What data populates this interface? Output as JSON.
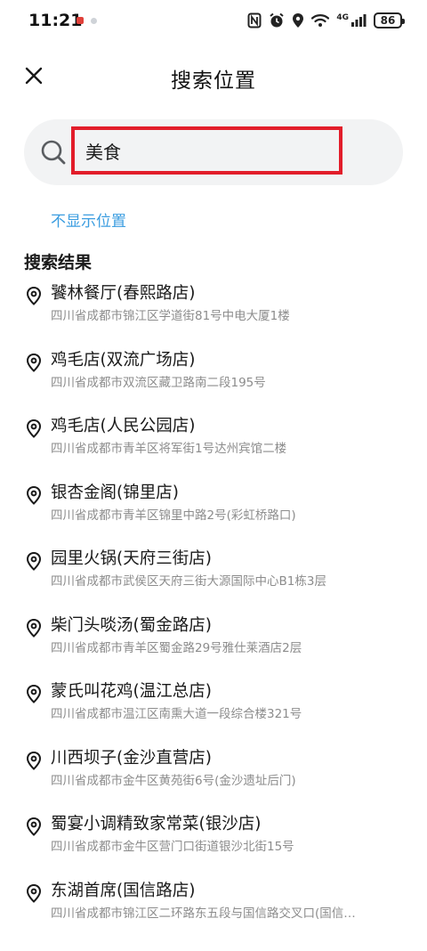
{
  "status_bar": {
    "time": "11:21",
    "network": "4G",
    "battery": "86"
  },
  "header": {
    "title": "搜索位置",
    "close_icon": "close-icon"
  },
  "search": {
    "value": "美食",
    "icon": "search-icon",
    "highlight_color": "#e21d2a"
  },
  "hide_location_label": "不显示位置",
  "results_title": "搜索结果",
  "results": [
    {
      "name": "饕林餐厅(春熙路店)",
      "address": "四川省成都市锦江区学道街81号中电大厦1楼"
    },
    {
      "name": "鸡毛店(双流广场店)",
      "address": "四川省成都市双流区藏卫路南二段195号"
    },
    {
      "name": "鸡毛店(人民公园店)",
      "address": "四川省成都市青羊区将军街1号达州宾馆二楼"
    },
    {
      "name": "银杏金阁(锦里店)",
      "address": "四川省成都市青羊区锦里中路2号(彩虹桥路口)"
    },
    {
      "name": "园里火锅(天府三街店)",
      "address": "四川省成都市武侯区天府三街大源国际中心B1栋3层"
    },
    {
      "name": "柴门头啖汤(蜀金路店)",
      "address": "四川省成都市青羊区蜀金路29号雅仕莱酒店2层"
    },
    {
      "name": "蒙氏叫花鸡(温江总店)",
      "address": "四川省成都市温江区南熏大道一段综合楼321号"
    },
    {
      "name": "川西坝子(金沙直营店)",
      "address": "四川省成都市金牛区黄苑街6号(金沙遗址后门)"
    },
    {
      "name": "蜀宴小调精致家常菜(银沙店)",
      "address": "四川省成都市金牛区营门口街道银沙北街15号"
    },
    {
      "name": "东湖首席(国信路店)",
      "address": "四川省成都市锦江区二环路东五段与国信路交叉口(国信…"
    }
  ],
  "colors": {
    "accent_link": "#3b9de0",
    "search_bg": "#f2f3f4",
    "address_text": "#8c8c8c"
  }
}
